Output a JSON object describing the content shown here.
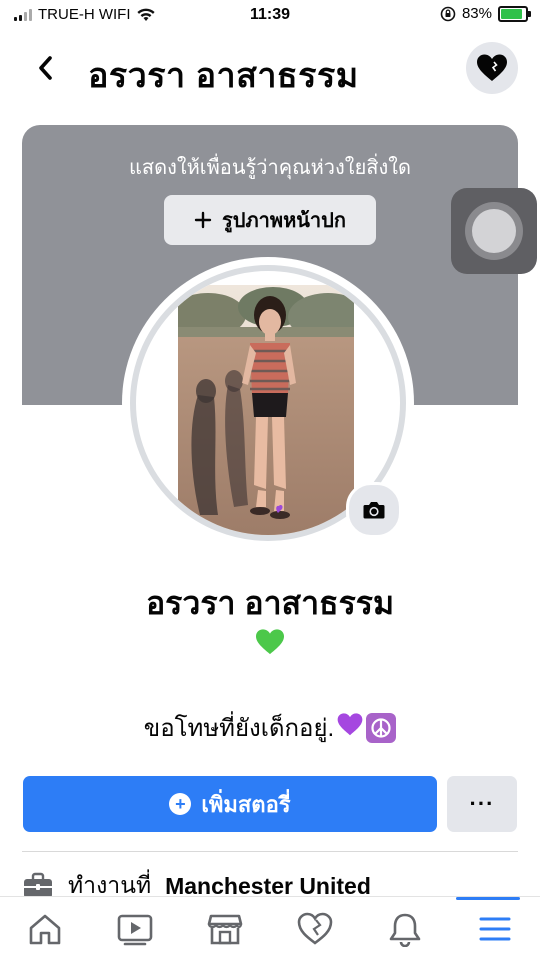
{
  "status_bar": {
    "carrier": "TRUE-H WIFI",
    "time": "11:39",
    "battery_percent": "83%",
    "battery_level": 0.83,
    "battery_color": "#2fc14a"
  },
  "header": {
    "back_icon": "chevron-left-icon",
    "title": "อรวรา อาสาธรรม",
    "heart_icon": "heart-icon"
  },
  "cover": {
    "prompt_text": "แสดงให้เพื่อนรู้ว่าคุณห่วงใยสิ่งใด",
    "button_label": "รูปภาพหน้าปก",
    "background": "#909298"
  },
  "profile": {
    "name": "อรวรา อาสาธรรม",
    "emoji": "green-heart",
    "bio_text": "ขอโทษที่ยังเด็กอยู่.",
    "bio_icons": [
      "purple-heart",
      "peace-symbol"
    ],
    "camera_icon": "camera-icon"
  },
  "actions": {
    "add_story_label": "เพิ่มสตอรี่",
    "more_label": "···",
    "accent": "#2d7df6"
  },
  "about": {
    "work_prefix": "ทำงานที่",
    "work_value": "Manchester United"
  },
  "bottom_nav": {
    "items": [
      "home-icon",
      "video-icon",
      "marketplace-icon",
      "dating-heart-icon",
      "bell-icon",
      "menu-icon"
    ],
    "active": "menu-icon"
  }
}
